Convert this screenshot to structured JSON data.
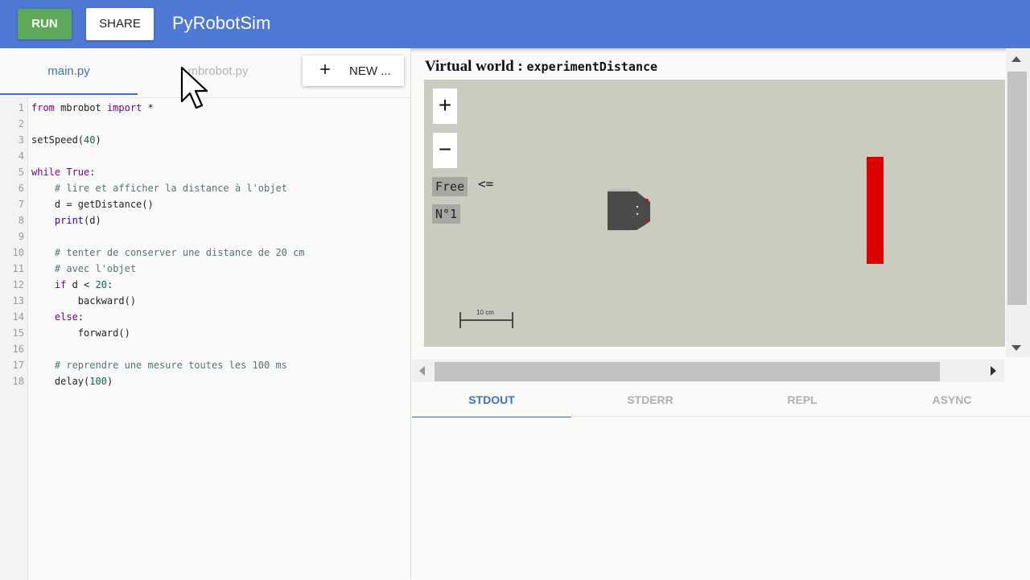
{
  "header": {
    "run_label": "RUN",
    "share_label": "SHARE",
    "app_title": "PyRobotSim",
    "bg_color": "#4f79d4",
    "run_color": "#5ea85a"
  },
  "files": {
    "tabs": [
      "main.py",
      "mbrobot.py"
    ],
    "active_tab": "main.py",
    "new_label": "NEW ..."
  },
  "editor": {
    "line_numbers": [
      "1",
      "2",
      "3",
      "4",
      "5",
      "6",
      "7",
      "8",
      "9",
      "10",
      "11",
      "12",
      "13",
      "14",
      "15",
      "16",
      "17",
      "18"
    ],
    "lines": [
      [
        [
          "kw",
          "from"
        ],
        [
          "",
          "mbrobot"
        ],
        [
          "kw",
          "import"
        ],
        [
          "",
          "*"
        ]
      ],
      [],
      [
        [
          "",
          "setSpeed("
        ],
        [
          "nm",
          "40"
        ],
        [
          "",
          ")"
        ]
      ],
      [],
      [
        [
          "kw",
          "while"
        ],
        [
          "kw",
          "True"
        ],
        [
          "",
          ":"
        ]
      ],
      [
        [
          "",
          "    "
        ],
        [
          "cm",
          "# lire et afficher la distance à l'objet"
        ]
      ],
      [
        [
          "",
          "    d = getDistance()"
        ]
      ],
      [
        [
          "",
          "    "
        ],
        [
          "bi",
          "print"
        ],
        [
          "",
          "(d)"
        ]
      ],
      [],
      [
        [
          "",
          "    "
        ],
        [
          "cm",
          "# tenter de conserver une distance de 20 cm"
        ]
      ],
      [
        [
          "",
          "    "
        ],
        [
          "cm",
          "# avec l'objet"
        ]
      ],
      [
        [
          "",
          "    "
        ],
        [
          "kw",
          "if"
        ],
        [
          "",
          " d < "
        ],
        [
          "nm",
          "20"
        ],
        [
          "",
          ":"
        ]
      ],
      [
        [
          "",
          "        backward()"
        ]
      ],
      [
        [
          "",
          "    "
        ],
        [
          "kw",
          "else"
        ],
        [
          "",
          ":"
        ]
      ],
      [
        [
          "",
          "        forward()"
        ]
      ],
      [],
      [
        [
          "",
          "    "
        ],
        [
          "cm",
          "# reprendre une mesure toutes les 100 ms"
        ]
      ],
      [
        [
          "",
          "    delay("
        ],
        [
          "nm",
          "100"
        ],
        [
          "",
          ")"
        ]
      ]
    ]
  },
  "world": {
    "title_prefix": "Virtual world : ",
    "world_name": "experimentDistance",
    "zoom_in": "+",
    "zoom_out": "−",
    "free_label": "Free",
    "arrow_label": "<=",
    "robot_number": "N°1",
    "scale_label": "10 cm",
    "canvas_color": "#cccbc0",
    "obstacle_color": "#dd0000"
  },
  "output": {
    "tabs": [
      "STDOUT",
      "STDERR",
      "REPL",
      "ASYNC"
    ],
    "active_tab": "STDOUT"
  }
}
